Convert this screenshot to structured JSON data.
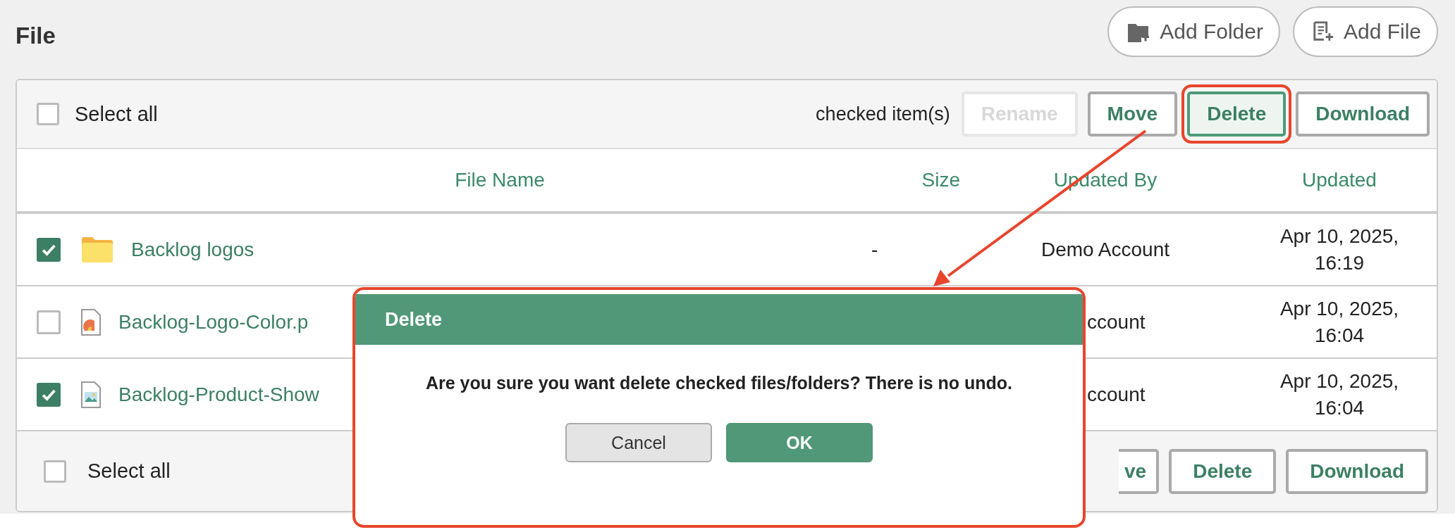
{
  "page": {
    "title": "File"
  },
  "header_buttons": [
    {
      "label": "Add Folder",
      "kind": "folder"
    },
    {
      "label": "Add File",
      "kind": "file"
    }
  ],
  "toolbar": {
    "select_all": {
      "label": "Select all",
      "checked": false
    },
    "caption": "checked item(s)",
    "buttons": [
      {
        "label": "Rename",
        "disabled": true,
        "highlighted": false
      },
      {
        "label": "Move",
        "disabled": false,
        "highlighted": false
      },
      {
        "label": "Delete",
        "disabled": false,
        "highlighted": true
      },
      {
        "label": "Download",
        "disabled": false,
        "highlighted": false
      }
    ]
  },
  "table": {
    "columns": [
      "File Name",
      "Size",
      "Updated By",
      "Updated"
    ],
    "rows": [
      {
        "checked": true,
        "kind": "folder",
        "name": "Backlog logos",
        "size": "-",
        "updated_by": "Demo Account",
        "updated": [
          "Apr 10, 2025,",
          "16:19"
        ]
      },
      {
        "checked": false,
        "kind": "logo-image",
        "name": "Backlog-Logo-Color.p",
        "updated_by": "ccount",
        "updated": [
          "Apr 10, 2025,",
          "16:04"
        ]
      },
      {
        "checked": true,
        "kind": "image",
        "name": "Backlog-Product-Show",
        "updated_by": "ccount",
        "updated": [
          "Apr 10, 2025,",
          "16:04"
        ]
      }
    ]
  },
  "footer": {
    "select_all": {
      "label": "Select all",
      "checked": false
    },
    "buttons": [
      {
        "label": "ve",
        "cut": true
      },
      {
        "label": "Delete",
        "cut": false
      },
      {
        "label": "Download",
        "cut": false
      }
    ]
  },
  "dialog": {
    "title": "Delete",
    "message": "Are you sure you want delete checked files/folders? There is no undo.",
    "buttons": [
      {
        "label": "Cancel",
        "kind": "secondary"
      },
      {
        "label": "OK",
        "kind": "primary"
      }
    ]
  }
}
